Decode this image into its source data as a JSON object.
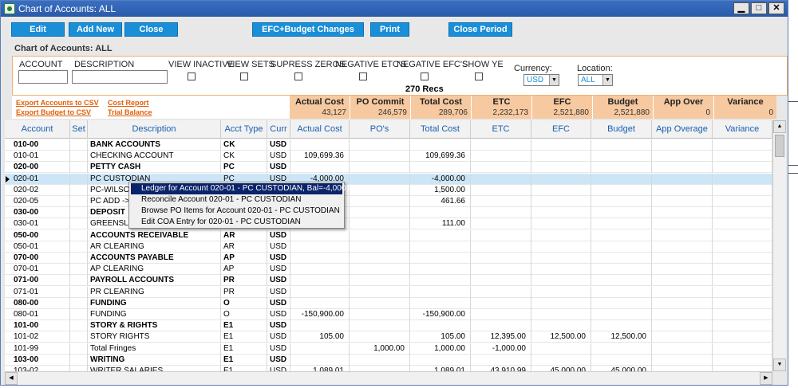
{
  "window": {
    "title": "Chart of Accounts: ALL",
    "minimize": "▁",
    "maximize": "□",
    "close": "✕"
  },
  "toolbar": {
    "edit": "Edit",
    "add_new": "Add New",
    "close": "Close",
    "efc_budget_changes": "EFC+Budget Changes",
    "print": "Print",
    "close_period": "Close Period"
  },
  "page_title": "Chart of Accounts: ALL",
  "filters": {
    "account_label": "ACCOUNT",
    "description_label": "DESCRIPTION",
    "view_inactive": "VIEW INACTIVE",
    "view_sets": "VIEW SETS",
    "supress_zeros": "SUPRESS ZEROS",
    "negative_etcs": "NEGATIVE ETC'S",
    "negative_efcs": "NEGATIVE EFC'S",
    "show_ye": "SHOW YE",
    "currency_label": "Currency:",
    "currency_value": "USD",
    "location_label": "Location:",
    "location_value": "ALL",
    "record_count": "270 Recs"
  },
  "links": {
    "export_accounts": "Export Accounts to CSV",
    "export_budget": "Export Budget to CSV",
    "cost_report": "Cost Report",
    "trial_balance": "Trial Balance"
  },
  "totals": [
    {
      "label": "Actual Cost",
      "value": "43,127"
    },
    {
      "label": "PO Commit",
      "value": "246,579"
    },
    {
      "label": "Total Cost",
      "value": "289,706"
    },
    {
      "label": "ETC",
      "value": "2,232,173"
    },
    {
      "label": "EFC",
      "value": "2,521,880"
    },
    {
      "label": "Budget",
      "value": "2,521,880"
    },
    {
      "label": "App Over",
      "value": "0"
    },
    {
      "label": "Variance",
      "value": "0"
    }
  ],
  "grid": {
    "headers": [
      "Account",
      "Set",
      "Description",
      "Acct Type",
      "Curr",
      "Actual Cost",
      "PO's",
      "Total Cost",
      "ETC",
      "EFC",
      "Budget",
      "App Overage",
      "Variance"
    ],
    "rows": [
      {
        "bold": true,
        "c": [
          "010-00",
          "",
          "BANK ACCOUNTS",
          "CK",
          "USD",
          "",
          "",
          "",
          "",
          "",
          "",
          "",
          ""
        ]
      },
      {
        "bold": false,
        "c": [
          "010-01",
          "",
          "CHECKING ACCOUNT",
          "CK",
          "USD",
          "109,699.36",
          "",
          "109,699.36",
          "",
          "",
          "",
          "",
          ""
        ]
      },
      {
        "bold": true,
        "c": [
          "020-00",
          "",
          "PETTY CASH",
          "PC",
          "USD",
          "",
          "",
          "",
          "",
          "",
          "",
          "",
          ""
        ]
      },
      {
        "bold": false,
        "sel": true,
        "c": [
          "020-01",
          "",
          "PC CUSTODIAN",
          "PC",
          "USD",
          "-4,000.00",
          "",
          "-4,000.00",
          "",
          "",
          "",
          "",
          ""
        ]
      },
      {
        "bold": false,
        "c": [
          "020-02",
          "",
          "PC-WILSON",
          "PC",
          "USD",
          "0",
          "",
          "1,500.00",
          "",
          "",
          "",
          "",
          ""
        ]
      },
      {
        "bold": false,
        "c": [
          "020-05",
          "",
          "PC ADD ->",
          "PC",
          "USD",
          "6",
          "",
          "461.66",
          "",
          "",
          "",
          "",
          ""
        ]
      },
      {
        "bold": true,
        "c": [
          "030-00",
          "",
          "DEPOSIT",
          "DP",
          "USD",
          "",
          "",
          "",
          "",
          "",
          "",
          "",
          ""
        ]
      },
      {
        "bold": false,
        "c": [
          "030-01",
          "",
          "GREENSLADE",
          "DP",
          "USD",
          "0",
          "",
          "111.00",
          "",
          "",
          "",
          "",
          ""
        ]
      },
      {
        "bold": true,
        "c": [
          "050-00",
          "",
          "ACCOUNTS RECEIVABLE",
          "AR",
          "USD",
          "",
          "",
          "",
          "",
          "",
          "",
          "",
          ""
        ]
      },
      {
        "bold": false,
        "c": [
          "050-01",
          "",
          "AR CLEARING",
          "AR",
          "USD",
          "",
          "",
          "",
          "",
          "",
          "",
          "",
          ""
        ]
      },
      {
        "bold": true,
        "c": [
          "070-00",
          "",
          "ACCOUNTS PAYABLE",
          "AP",
          "USD",
          "",
          "",
          "",
          "",
          "",
          "",
          "",
          ""
        ]
      },
      {
        "bold": false,
        "c": [
          "070-01",
          "",
          "AP CLEARING",
          "AP",
          "USD",
          "",
          "",
          "",
          "",
          "",
          "",
          "",
          ""
        ]
      },
      {
        "bold": true,
        "c": [
          "071-00",
          "",
          "PAYROLL ACCOUNTS",
          "PR",
          "USD",
          "",
          "",
          "",
          "",
          "",
          "",
          "",
          ""
        ]
      },
      {
        "bold": false,
        "c": [
          "071-01",
          "",
          "PR CLEARING",
          "PR",
          "USD",
          "",
          "",
          "",
          "",
          "",
          "",
          "",
          ""
        ]
      },
      {
        "bold": true,
        "c": [
          "080-00",
          "",
          "FUNDING",
          "O",
          "USD",
          "",
          "",
          "",
          "",
          "",
          "",
          "",
          ""
        ]
      },
      {
        "bold": false,
        "c": [
          "080-01",
          "",
          "FUNDING",
          "O",
          "USD",
          "-150,900.00",
          "",
          "-150,900.00",
          "",
          "",
          "",
          "",
          ""
        ]
      },
      {
        "bold": true,
        "c": [
          "101-00",
          "",
          "STORY & RIGHTS",
          "E1",
          "USD",
          "",
          "",
          "",
          "",
          "",
          "",
          "",
          ""
        ]
      },
      {
        "bold": false,
        "c": [
          "101-02",
          "",
          "STORY RIGHTS",
          "E1",
          "USD",
          "105.00",
          "",
          "105.00",
          "12,395.00",
          "12,500.00",
          "12,500.00",
          "",
          ""
        ]
      },
      {
        "bold": false,
        "c": [
          "101-99",
          "",
          "Total Fringes",
          "E1",
          "USD",
          "",
          "1,000.00",
          "1,000.00",
          "-1,000.00",
          "",
          "",
          "",
          ""
        ]
      },
      {
        "bold": true,
        "c": [
          "103-00",
          "",
          "WRITING",
          "E1",
          "USD",
          "",
          "",
          "",
          "",
          "",
          "",
          "",
          ""
        ]
      },
      {
        "bold": false,
        "c": [
          "103-02",
          "",
          "WRITER SALARIES",
          "E1",
          "USD",
          "1,089.01",
          "",
          "1,089.01",
          "43,910.99",
          "45,000.00",
          "45,000.00",
          "",
          ""
        ]
      }
    ]
  },
  "context_menu": [
    "Ledger for Account 020-01 - PC CUSTODIAN,  Bal=-4,000.00",
    "Reconcile Account 020-01 - PC CUSTODIAN",
    "Browse PO Items for Account 020-01 - PC CUSTODIAN",
    "Edit COA Entry for 020-01 - PC CUSTODIAN"
  ]
}
